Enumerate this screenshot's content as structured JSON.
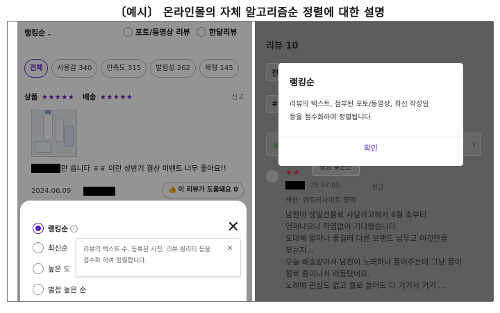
{
  "caption": "〔예시〕 온라인몰의 자체 알고리즘순 정렬에 대한 설명",
  "left": {
    "sort_label": "랭킹순",
    "filter_photo": "포토/동영상 리뷰",
    "filter_monthly": "한달리뷰",
    "chips": [
      "전체",
      "사용감 340",
      "만족도 315",
      "발림성 262",
      "제형 145"
    ],
    "rating_product": "상품",
    "rating_delivery": "배송",
    "stars": "★★★★★",
    "report": "신고",
    "review_text": "만 씁니다 ㅎㅎ 이런 상반기 결산 이벤트 너무 좋아요!!",
    "review_date": "2024.06.09",
    "helpful_label": "이 리뷰가 도움돼요 0",
    "sort_options": [
      "랭킹순",
      "최신순",
      "높은 도",
      "별점 높은 순"
    ],
    "tooltip_line1": "리뷰의 텍스트 수, 등록된 사진, 리뷰 퀄리티 등을",
    "tooltip_line2": "점수화 하여 정렬합니다.",
    "icons": {
      "close": "✕",
      "info": "i",
      "chevron": "⌄",
      "thumb": "👍"
    }
  },
  "right": {
    "title": "리뷰 10",
    "bit1": "전",
    "bit2": "#",
    "chip": "랭킹 낮은순",
    "stars": "★★",
    "review_date": "25.07.01.",
    "report": "신고",
    "color_line": "색상: 엔트리사이트 블랙",
    "body_lines": [
      "남편이 생일선물로 사달라고해서 6월 초부터",
      "언제나오나 하염없이 기다렸습니다.",
      "도대체 얼마나 좋길래 다른 브랜드 납두고 이것만을",
      "찾는지...",
      "오늘 배송받아서 남편이 노래하나 틀어주는데 그냥 몸이",
      "절로 흥이나서 리듬탔네요.",
      "노래에 관심도 없고 뭘로 들어도 다 거기서 거기 ..."
    ],
    "modal": {
      "title": "랭킹순",
      "body_line1": "리뷰의 텍스트, 첨부된 포토/동영상, 최신 작성일",
      "body_line2": "등을 점수화하여 정렬됩니다.",
      "confirm": "확인"
    }
  }
}
